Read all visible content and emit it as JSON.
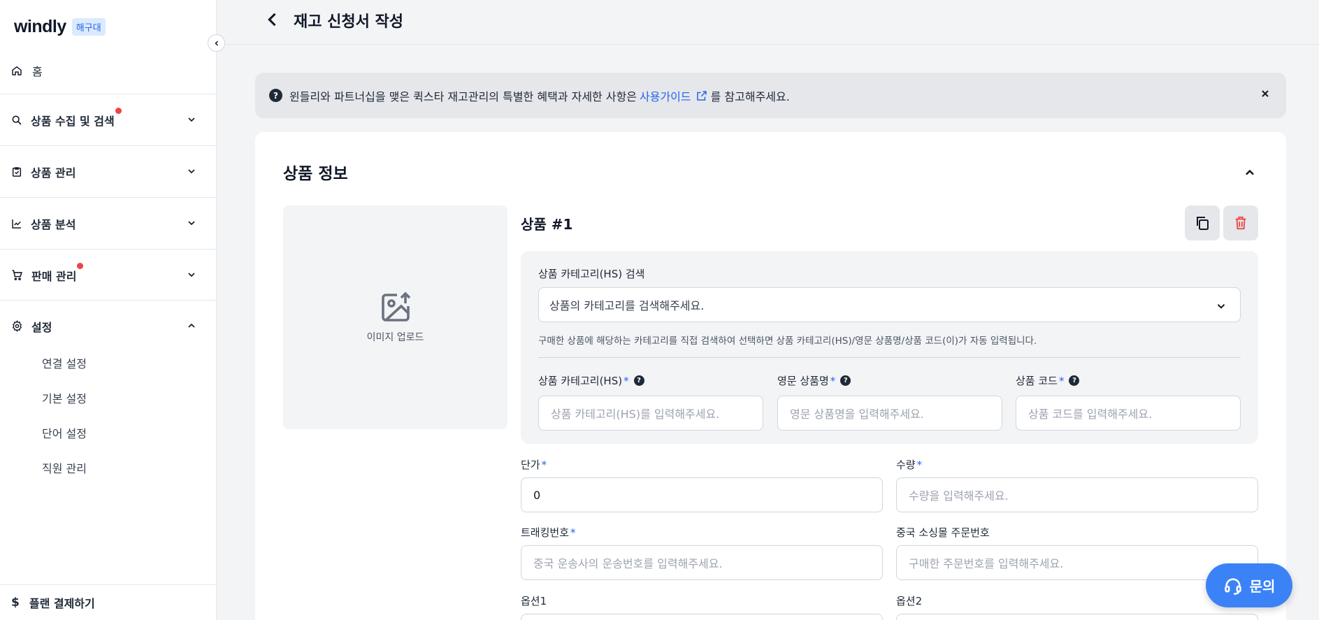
{
  "brand": {
    "logo": "windly",
    "region": "해구대"
  },
  "sidebar": {
    "home": "홈",
    "sections": [
      {
        "label": "상품 수집 및 검색",
        "icon": "search-icon",
        "badge": true,
        "expanded": false
      },
      {
        "label": "상품 관리",
        "icon": "clipboard-check-icon",
        "badge": false,
        "expanded": false
      },
      {
        "label": "상품 분석",
        "icon": "chart-line-icon",
        "badge": false,
        "expanded": false
      },
      {
        "label": "판매 관리",
        "icon": "cart-icon",
        "badge": true,
        "expanded": false
      },
      {
        "label": "설정",
        "icon": "gear-icon",
        "badge": false,
        "expanded": true
      }
    ],
    "settings_items": [
      "연결 설정",
      "기본 설정",
      "단어 설정",
      "직원 관리"
    ],
    "plan": "플랜 결제하기"
  },
  "header": {
    "title": "재고 신청서 작성"
  },
  "notice": {
    "text_before": "윈들리와 파트너십을 맺은 퀵스타 재고관리의 특별한 혜택과 자세한 사항은",
    "link": "사용가이드",
    "text_after": "를 참고해주세요."
  },
  "card": {
    "title": "상품 정보",
    "upload_label": "이미지 업로드",
    "product_title": "상품 #1",
    "hs_search": {
      "label": "상품 카테고리(HS) 검색",
      "placeholder": "상품의 카테고리를 검색해주세요.",
      "hint": "구매한 상품에 해당하는 카테고리를 직접 검색하여 선택하면 상품 카테고리(HS)/영문 상품명/상품 코드(이)가 자동 입력됩니다."
    },
    "fields": {
      "hs": {
        "label": "상품 카테고리(HS)",
        "placeholder": "상품 카테고리(HS)를 입력해주세요."
      },
      "eng_name": {
        "label": "영문 상품명",
        "placeholder": "영문 상품명을 입력해주세요."
      },
      "code": {
        "label": "상품 코드",
        "placeholder": "상품 코드를 입력해주세요."
      },
      "price": {
        "label": "단가",
        "value": "0"
      },
      "qty": {
        "label": "수량",
        "placeholder": "수량을 입력해주세요."
      },
      "tracking": {
        "label": "트래킹번호",
        "placeholder": "중국 운송사의 운송번호를 입력해주세요."
      },
      "order_no": {
        "label": "중국 소싱몰 주문번호",
        "placeholder": "구매한 주문번호를 입력해주세요."
      },
      "opt1": {
        "label": "옵션1"
      },
      "opt2": {
        "label": "옵션2"
      }
    },
    "required_mark": "*"
  },
  "chat": {
    "label": "문의"
  },
  "colors": {
    "accent": "#2563eb",
    "badge": "#ef4444",
    "fab": "#3b82f6",
    "delete": "#ef4444"
  }
}
